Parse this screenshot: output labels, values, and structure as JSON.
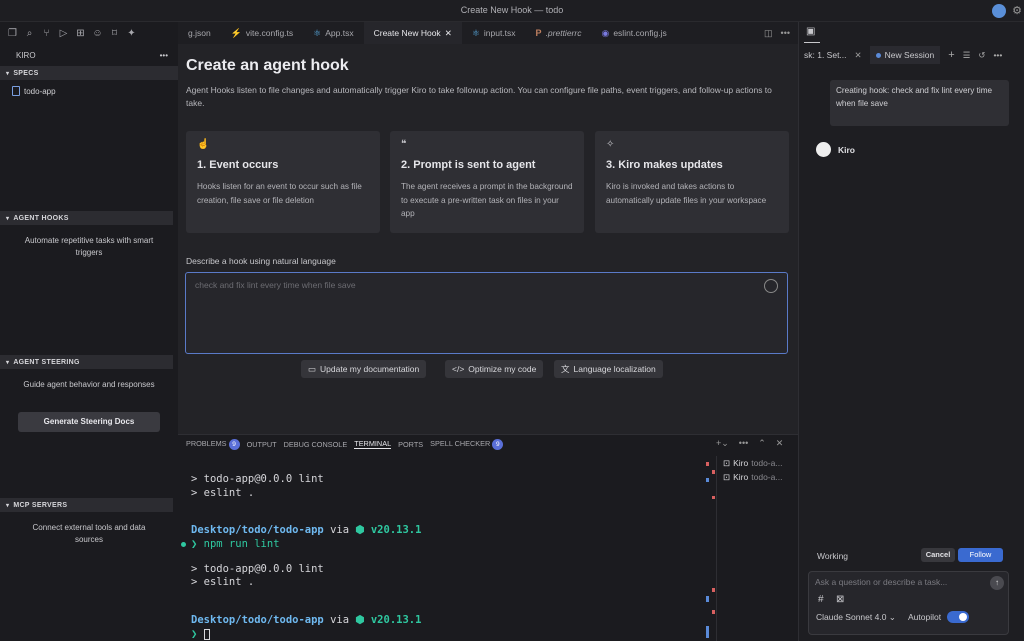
{
  "window": {
    "title": "Create New Hook — todo"
  },
  "sidebar": {
    "header": "KIRO",
    "specs": {
      "title": "SPECS",
      "items": [
        "todo-app"
      ]
    },
    "hooks": {
      "title": "AGENT HOOKS",
      "desc": "Automate repetitive tasks with smart triggers"
    },
    "steering": {
      "title": "AGENT STEERING",
      "desc": "Guide agent behavior and responses",
      "button": "Generate Steering Docs"
    },
    "mcp": {
      "title": "MCP SERVERS",
      "desc": "Connect external tools and data sources"
    }
  },
  "tabs": [
    {
      "label": "g.json",
      "icon": "",
      "active": false
    },
    {
      "label": "vite.config.ts",
      "icon": "⚡",
      "active": false
    },
    {
      "label": "App.tsx",
      "icon": "⚛",
      "active": false
    },
    {
      "label": "Create New Hook",
      "icon": "",
      "active": true
    },
    {
      "label": "input.tsx",
      "icon": "⚛",
      "active": false
    },
    {
      "label": ".prettierrc",
      "icon": "P",
      "active": false
    },
    {
      "label": "eslint.config.js",
      "icon": "◉",
      "active": false
    }
  ],
  "hook": {
    "title": "Create an agent hook",
    "intro": "Agent Hooks listen to file changes and automatically trigger Kiro to take followup action. You can configure file paths, event triggers, and follow-up actions to take.",
    "cards": [
      {
        "title": "1. Event occurs",
        "desc": "Hooks listen for an event to occur such as file creation, file save or file deletion"
      },
      {
        "title": "2. Prompt is sent to agent",
        "desc": "The agent receives a prompt in the background to execute a pre-written task on files in your app"
      },
      {
        "title": "3. Kiro makes updates",
        "desc": "Kiro is invoked and takes actions to automatically update files in your workspace"
      }
    ],
    "describe_label": "Describe a hook using natural language",
    "input_placeholder": "check and fix lint every time when file save",
    "chips": [
      "Update my documentation",
      "Optimize my code",
      "Language localization"
    ]
  },
  "panel": {
    "tabs": [
      {
        "label": "PROBLEMS",
        "badge": "9"
      },
      {
        "label": "OUTPUT"
      },
      {
        "label": "DEBUG CONSOLE"
      },
      {
        "label": "TERMINAL"
      },
      {
        "label": "PORTS"
      },
      {
        "label": "SPELL CHECKER",
        "badge": "9"
      }
    ],
    "terminal": {
      "l1": "> todo-app@0.0.0 lint",
      "l2": "> eslint .",
      "path": "Desktop/todo/todo-app",
      "via": " via ",
      "node": "⬢ v20.13.1",
      "prompt": "❯ ",
      "cmd": "npm run lint",
      "l3": "> todo-app@0.0.0 lint",
      "l4": "> eslint ."
    },
    "terminals": [
      {
        "label": "Kiro",
        "sub": "todo-a..."
      },
      {
        "label": "Kiro",
        "sub": "todo-a..."
      }
    ]
  },
  "chat": {
    "tab1": "sk: 1. Set...",
    "tab2": "New Session",
    "user_msg": "Creating hook: check and fix lint every time when file save",
    "agent": "Kiro",
    "status": "Working",
    "cancel": "Cancel",
    "follow": "Follow",
    "placeholder": "Ask a question or describe a task...",
    "model": "Claude Sonnet 4.0",
    "autopilot": "Autopilot"
  }
}
